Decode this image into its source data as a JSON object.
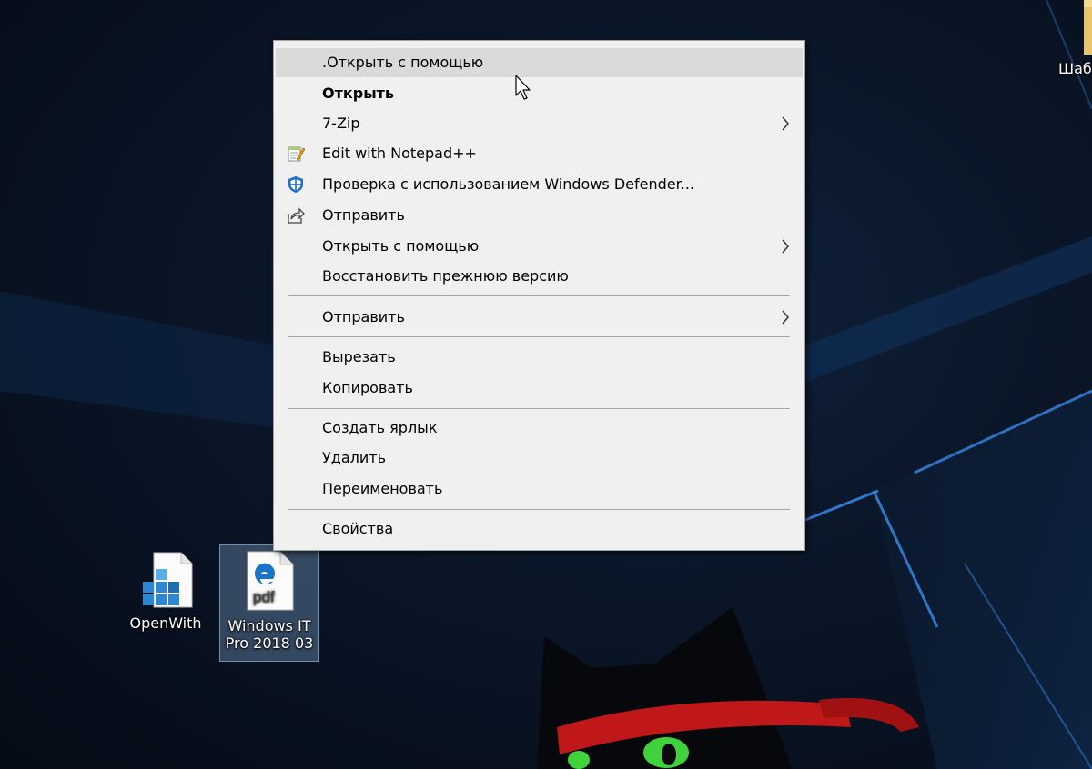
{
  "colors": {
    "menu_background": "#f0f0f0",
    "menu_highlight": "#dadada",
    "separator": "#a6a6a6",
    "desktop_background": "#0a1628",
    "icon_selection": "#7da0c8"
  },
  "context_menu": {
    "items": [
      {
        "label": ".Открыть с помощью",
        "icon": null,
        "bold": false,
        "submenu": false,
        "highlighted": true
      },
      {
        "label": "Открыть",
        "icon": null,
        "bold": true,
        "submenu": false,
        "highlighted": false
      },
      {
        "label": "7-Zip",
        "icon": null,
        "bold": false,
        "submenu": true,
        "highlighted": false
      },
      {
        "label": "Edit with Notepad++",
        "icon": "notepad-plus-plus-icon",
        "bold": false,
        "submenu": false,
        "highlighted": false
      },
      {
        "label": "Проверка с использованием Windows Defender...",
        "icon": "windows-defender-shield-icon",
        "bold": false,
        "submenu": false,
        "highlighted": false
      },
      {
        "label": "Отправить",
        "icon": "share-icon",
        "bold": false,
        "submenu": false,
        "highlighted": false
      },
      {
        "label": "Открыть с помощью",
        "icon": null,
        "bold": false,
        "submenu": true,
        "highlighted": false
      },
      {
        "label": "Восстановить прежнюю версию",
        "icon": null,
        "bold": false,
        "submenu": false,
        "highlighted": false
      },
      {
        "label": "Отправить",
        "icon": null,
        "bold": false,
        "submenu": true,
        "highlighted": false
      },
      {
        "label": "Вырезать",
        "icon": null,
        "bold": false,
        "submenu": false,
        "highlighted": false
      },
      {
        "label": "Копировать",
        "icon": null,
        "bold": false,
        "submenu": false,
        "highlighted": false
      },
      {
        "label": "Создать ярлык",
        "icon": null,
        "bold": false,
        "submenu": false,
        "highlighted": false
      },
      {
        "label": "Удалить",
        "icon": null,
        "bold": false,
        "submenu": false,
        "highlighted": false
      },
      {
        "label": "Переименовать",
        "icon": null,
        "bold": false,
        "submenu": false,
        "highlighted": false
      },
      {
        "label": "Свойства",
        "icon": null,
        "bold": false,
        "submenu": false,
        "highlighted": false
      }
    ]
  },
  "desktop": {
    "icons": [
      {
        "label": "OpenWith",
        "icon": "registry-file-icon",
        "selected": false
      },
      {
        "label_line1": "Windows IT",
        "label_line2": "Pro 2018 03",
        "icon": "edge-pdf-file-icon",
        "selected": true
      },
      {
        "label": "Шаб",
        "icon": "folder-icon",
        "selected": false
      }
    ]
  }
}
